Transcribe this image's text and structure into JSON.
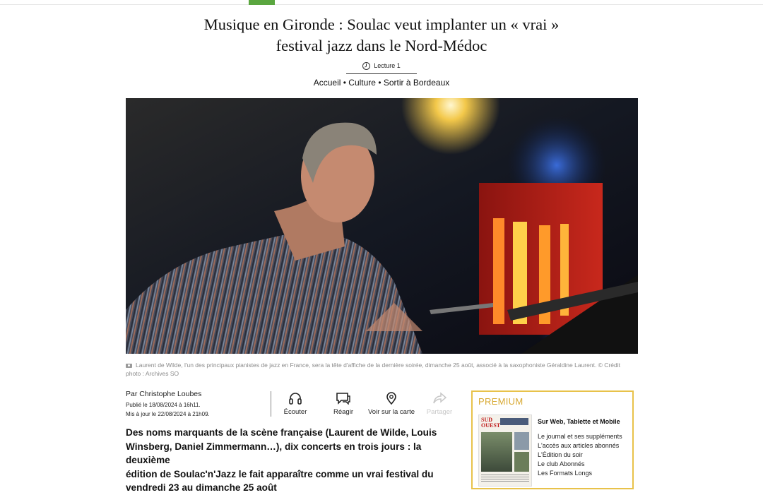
{
  "article": {
    "title_line1": "Musique en Gironde : Soulac veut implanter un « vrai »",
    "title_line2": "festival jazz dans le Nord-Médoc",
    "reading_label": "Lecture 1",
    "breadcrumb": [
      "Accueil",
      "Culture",
      "Sortir à Bordeaux"
    ],
    "caption_line1": "Laurent de Wilde, l'un des principaux pianistes de jazz en France, sera la tête d'affiche de la dernière soirée, dimanche 25 août, associé à la saxophoniste Géraldine Laurent. © Crédit",
    "caption_line2": "photo : Archives SO",
    "author": "Par Christophe Loubes",
    "published": "Publié le 18/08/2024 à 16h11.",
    "updated": "Mis à jour le 22/08/2024 à 21h09.",
    "lead_line1": "Des noms marquants de la scène française (Laurent de Wilde, Louis",
    "lead_line2": "Winsberg, Daniel Zimmermann…), dix concerts en trois jours : la deuxième",
    "lead_line3": "édition de Soulac'n'Jazz le fait apparaître comme un vrai festival du",
    "lead_line4": "vendredi 23 au dimanche 25 août"
  },
  "actions": [
    {
      "label": "Écouter",
      "icon": "headphones-icon"
    },
    {
      "label": "Réagir",
      "icon": "comment-icon"
    },
    {
      "label": "Voir sur la carte",
      "icon": "map-pin-icon"
    },
    {
      "label": "Partager",
      "icon": "share-icon"
    }
  ],
  "premium": {
    "label": "PREMIUM",
    "heading": "Sur Web, Tablette et Mobile",
    "items": [
      "Le journal et ses suppléments",
      "L'accès aux articles abonnés",
      "L'Édition du soir",
      "Le club Abonnés",
      "Les Formats Longs"
    ],
    "paper_mast_1": "SUD",
    "paper_mast_2": "OUEST"
  },
  "colors": {
    "accent": "#5aa63f",
    "premium_gold": "#d8a932"
  }
}
